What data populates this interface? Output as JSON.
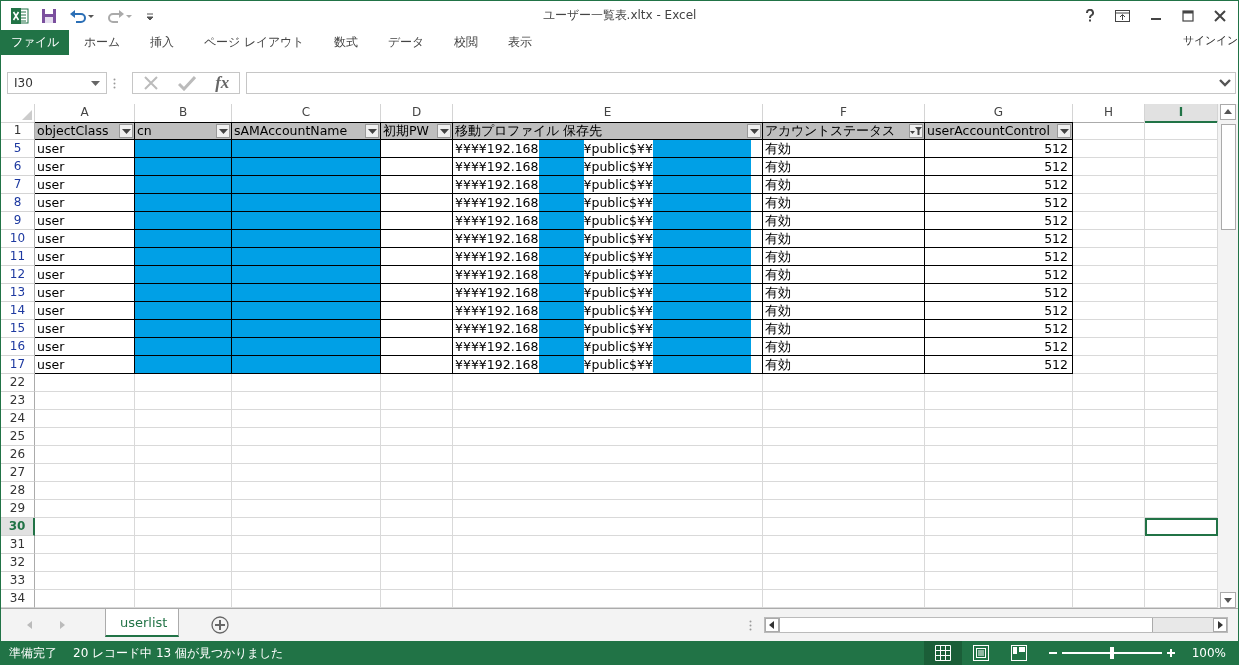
{
  "window": {
    "title": "ユーザー一覧表.xltx - Excel",
    "sign_in": "サインイン"
  },
  "ribbon_tabs": [
    {
      "label": "ファイル",
      "kind": "file"
    },
    {
      "label": "ホーム",
      "kind": "tab"
    },
    {
      "label": "挿入",
      "kind": "tab"
    },
    {
      "label": "ページ レイアウト",
      "kind": "tab"
    },
    {
      "label": "数式",
      "kind": "tab"
    },
    {
      "label": "データ",
      "kind": "tab"
    },
    {
      "label": "校閲",
      "kind": "tab"
    },
    {
      "label": "表示",
      "kind": "tab"
    }
  ],
  "formula_bar": {
    "name_box": "I30",
    "fx_label": "fx"
  },
  "sheet": {
    "columns": [
      {
        "letter": "A",
        "selected": false
      },
      {
        "letter": "B",
        "selected": false
      },
      {
        "letter": "C",
        "selected": false
      },
      {
        "letter": "D",
        "selected": false
      },
      {
        "letter": "E",
        "selected": false
      },
      {
        "letter": "F",
        "selected": false
      },
      {
        "letter": "G",
        "selected": false
      },
      {
        "letter": "H",
        "selected": false
      },
      {
        "letter": "I",
        "selected": true
      }
    ],
    "rows": [
      {
        "number": "1",
        "kind": "header",
        "selected": false,
        "cells": [
          {
            "label": "objectClass",
            "filtered": false
          },
          {
            "label": "cn",
            "filtered": false
          },
          {
            "label": "sAMAccountName",
            "filtered": false
          },
          {
            "label": "初期PW",
            "filtered": false
          },
          {
            "label": "移動プロファイル 保存先",
            "filtered": false
          },
          {
            "label": "アカウントステータス",
            "filtered": true
          },
          {
            "label": "userAccountControl",
            "filtered": false
          }
        ]
      },
      {
        "number": "5",
        "kind": "data",
        "selected": false,
        "cells": [
          {
            "kind": "text",
            "text": "user"
          },
          {
            "kind": "redacted"
          },
          {
            "kind": "redacted"
          },
          {
            "kind": "blank"
          },
          {
            "kind": "path",
            "parts": [
              "¥¥¥¥192.168",
              "¥public$¥¥"
            ]
          },
          {
            "kind": "text",
            "text": "有効"
          },
          {
            "kind": "num",
            "text": "512"
          }
        ]
      },
      {
        "number": "6",
        "kind": "data",
        "selected": false,
        "cells": [
          {
            "kind": "text",
            "text": "user"
          },
          {
            "kind": "redacted"
          },
          {
            "kind": "redacted"
          },
          {
            "kind": "blank"
          },
          {
            "kind": "path",
            "parts": [
              "¥¥¥¥192.168",
              "¥public$¥¥"
            ]
          },
          {
            "kind": "text",
            "text": "有効"
          },
          {
            "kind": "num",
            "text": "512"
          }
        ]
      },
      {
        "number": "7",
        "kind": "data",
        "selected": false,
        "cells": [
          {
            "kind": "text",
            "text": "user"
          },
          {
            "kind": "redacted"
          },
          {
            "kind": "redacted"
          },
          {
            "kind": "blank"
          },
          {
            "kind": "path",
            "parts": [
              "¥¥¥¥192.168",
              "¥public$¥¥"
            ]
          },
          {
            "kind": "text",
            "text": "有効"
          },
          {
            "kind": "num",
            "text": "512"
          }
        ]
      },
      {
        "number": "8",
        "kind": "data",
        "selected": false,
        "cells": [
          {
            "kind": "text",
            "text": "user"
          },
          {
            "kind": "redacted"
          },
          {
            "kind": "redacted"
          },
          {
            "kind": "blank"
          },
          {
            "kind": "path",
            "parts": [
              "¥¥¥¥192.168",
              "¥public$¥¥"
            ]
          },
          {
            "kind": "text",
            "text": "有効"
          },
          {
            "kind": "num",
            "text": "512"
          }
        ]
      },
      {
        "number": "9",
        "kind": "data",
        "selected": false,
        "cells": [
          {
            "kind": "text",
            "text": "user"
          },
          {
            "kind": "redacted"
          },
          {
            "kind": "redacted"
          },
          {
            "kind": "blank"
          },
          {
            "kind": "path",
            "parts": [
              "¥¥¥¥192.168",
              "¥public$¥¥"
            ]
          },
          {
            "kind": "text",
            "text": "有効"
          },
          {
            "kind": "num",
            "text": "512"
          }
        ]
      },
      {
        "number": "10",
        "kind": "data",
        "selected": false,
        "cells": [
          {
            "kind": "text",
            "text": "user"
          },
          {
            "kind": "redacted"
          },
          {
            "kind": "redacted"
          },
          {
            "kind": "blank"
          },
          {
            "kind": "path",
            "parts": [
              "¥¥¥¥192.168",
              "¥public$¥¥"
            ]
          },
          {
            "kind": "text",
            "text": "有効"
          },
          {
            "kind": "num",
            "text": "512"
          }
        ]
      },
      {
        "number": "11",
        "kind": "data",
        "selected": false,
        "cells": [
          {
            "kind": "text",
            "text": "user"
          },
          {
            "kind": "redacted"
          },
          {
            "kind": "redacted"
          },
          {
            "kind": "blank"
          },
          {
            "kind": "path",
            "parts": [
              "¥¥¥¥192.168",
              "¥public$¥¥"
            ]
          },
          {
            "kind": "text",
            "text": "有効"
          },
          {
            "kind": "num",
            "text": "512"
          }
        ]
      },
      {
        "number": "12",
        "kind": "data",
        "selected": false,
        "cells": [
          {
            "kind": "text",
            "text": "user"
          },
          {
            "kind": "redacted"
          },
          {
            "kind": "redacted"
          },
          {
            "kind": "blank"
          },
          {
            "kind": "path",
            "parts": [
              "¥¥¥¥192.168",
              "¥public$¥¥"
            ]
          },
          {
            "kind": "text",
            "text": "有効"
          },
          {
            "kind": "num",
            "text": "512"
          }
        ]
      },
      {
        "number": "13",
        "kind": "data",
        "selected": false,
        "cells": [
          {
            "kind": "text",
            "text": "user"
          },
          {
            "kind": "redacted"
          },
          {
            "kind": "redacted"
          },
          {
            "kind": "blank"
          },
          {
            "kind": "path",
            "parts": [
              "¥¥¥¥192.168",
              "¥public$¥¥"
            ]
          },
          {
            "kind": "text",
            "text": "有効"
          },
          {
            "kind": "num",
            "text": "512"
          }
        ]
      },
      {
        "number": "14",
        "kind": "data",
        "selected": false,
        "cells": [
          {
            "kind": "text",
            "text": "user"
          },
          {
            "kind": "redacted"
          },
          {
            "kind": "redacted"
          },
          {
            "kind": "blank"
          },
          {
            "kind": "path",
            "parts": [
              "¥¥¥¥192.168",
              "¥public$¥¥"
            ]
          },
          {
            "kind": "text",
            "text": "有効"
          },
          {
            "kind": "num",
            "text": "512"
          }
        ]
      },
      {
        "number": "15",
        "kind": "data",
        "selected": false,
        "cells": [
          {
            "kind": "text",
            "text": "user"
          },
          {
            "kind": "redacted"
          },
          {
            "kind": "redacted"
          },
          {
            "kind": "blank"
          },
          {
            "kind": "path",
            "parts": [
              "¥¥¥¥192.168",
              "¥public$¥¥"
            ]
          },
          {
            "kind": "text",
            "text": "有効"
          },
          {
            "kind": "num",
            "text": "512"
          }
        ]
      },
      {
        "number": "16",
        "kind": "data",
        "selected": false,
        "cells": [
          {
            "kind": "text",
            "text": "user"
          },
          {
            "kind": "redacted"
          },
          {
            "kind": "redacted"
          },
          {
            "kind": "blank"
          },
          {
            "kind": "path",
            "parts": [
              "¥¥¥¥192.168",
              "¥public$¥¥"
            ]
          },
          {
            "kind": "text",
            "text": "有効"
          },
          {
            "kind": "num",
            "text": "512"
          }
        ]
      },
      {
        "number": "17",
        "kind": "data",
        "selected": false,
        "cells": [
          {
            "kind": "text",
            "text": "user"
          },
          {
            "kind": "redacted"
          },
          {
            "kind": "redacted"
          },
          {
            "kind": "blank"
          },
          {
            "kind": "path",
            "parts": [
              "¥¥¥¥192.168",
              "¥public$¥¥"
            ]
          },
          {
            "kind": "text",
            "text": "有効"
          },
          {
            "kind": "num",
            "text": "512"
          }
        ]
      },
      {
        "number": "22",
        "kind": "empty",
        "selected": false
      },
      {
        "number": "23",
        "kind": "empty",
        "selected": false
      },
      {
        "number": "24",
        "kind": "empty",
        "selected": false
      },
      {
        "number": "25",
        "kind": "empty",
        "selected": false
      },
      {
        "number": "26",
        "kind": "empty",
        "selected": false
      },
      {
        "number": "27",
        "kind": "empty",
        "selected": false
      },
      {
        "number": "28",
        "kind": "empty",
        "selected": false
      },
      {
        "number": "29",
        "kind": "empty",
        "selected": false
      },
      {
        "number": "30",
        "kind": "empty",
        "selected": true
      },
      {
        "number": "31",
        "kind": "empty",
        "selected": false
      },
      {
        "number": "32",
        "kind": "empty",
        "selected": false
      },
      {
        "number": "33",
        "kind": "empty",
        "selected": false
      },
      {
        "number": "34",
        "kind": "empty",
        "selected": false
      }
    ]
  },
  "sheet_tabs": [
    {
      "label": "userlist",
      "selected": true
    }
  ],
  "status_bar": {
    "mode": "準備完了",
    "message": "20 レコード中 13 個が見つかりました",
    "views": [
      {
        "kind": "normal",
        "selected": true
      },
      {
        "kind": "page_layout",
        "selected": false
      },
      {
        "kind": "page_break",
        "selected": false
      }
    ],
    "zoom": {
      "level": 0.5,
      "reading": "100%"
    }
  }
}
